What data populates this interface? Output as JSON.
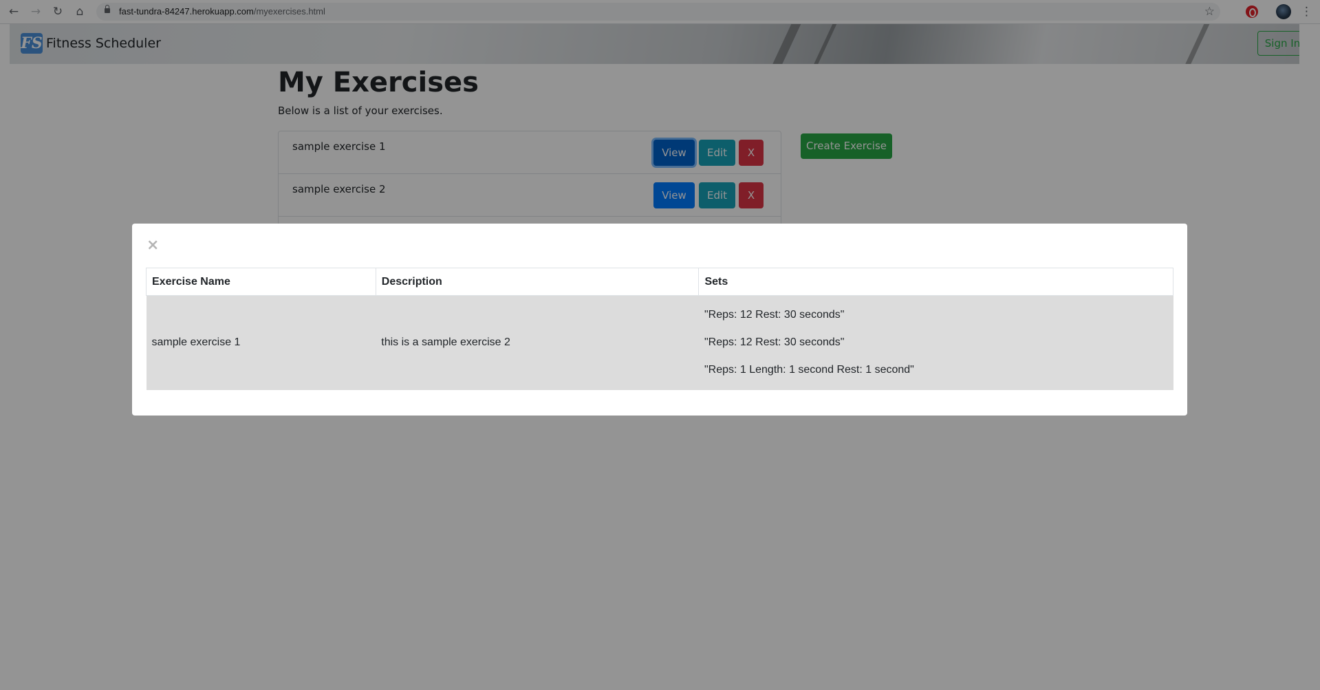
{
  "browser": {
    "url_host": "fast-tundra-84247.herokuapp.com",
    "url_path": "/myexercises.html"
  },
  "site": {
    "brand_logo_text": "FS",
    "brand_name": "Fitness Scheduler",
    "signin_label": "Sign In"
  },
  "page": {
    "title": "My Exercises",
    "subtitle": "Below is a list of your exercises.",
    "create_label": "Create Exercise",
    "exercises": [
      {
        "name": "sample exercise 1",
        "view": "View",
        "edit": "Edit",
        "delete": "X"
      },
      {
        "name": "sample exercise 2",
        "view": "View",
        "edit": "Edit",
        "delete": "X"
      }
    ]
  },
  "modal": {
    "close_glyph": "×",
    "headers": {
      "name": "Exercise Name",
      "description": "Description",
      "sets": "Sets"
    },
    "row": {
      "name": "sample exercise 1",
      "description": "this is a sample exercise 2",
      "sets": [
        "\"Reps: 12 Rest: 30 seconds\"",
        "\"Reps: 12 Rest: 30 seconds\"",
        "\"Reps: 1 Length: 1 second Rest: 1 second\""
      ]
    }
  },
  "colors": {
    "primary": "#007bff",
    "info": "#17a2b8",
    "danger": "#dc3545",
    "success": "#28a745"
  }
}
